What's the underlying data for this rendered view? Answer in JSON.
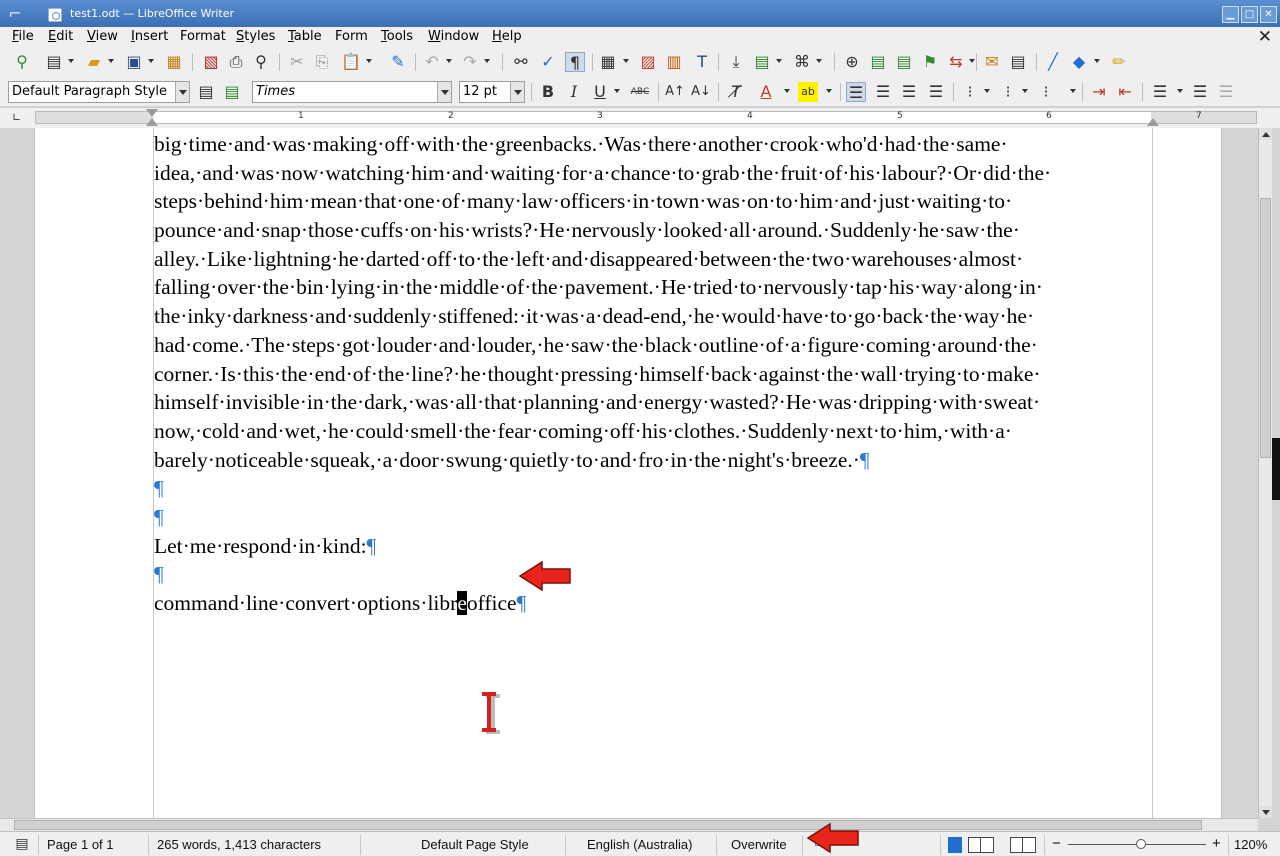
{
  "window": {
    "title": "test1.odt — LibreOffice Writer",
    "controls": {
      "minimize": "▁",
      "maximize": "□",
      "close": "✕"
    }
  },
  "menubar": {
    "items": [
      {
        "mnemonic": "F",
        "rest": "ile"
      },
      {
        "mnemonic": "E",
        "rest": "dit"
      },
      {
        "mnemonic": "V",
        "rest": "iew"
      },
      {
        "mnemonic": "I",
        "rest": "nsert"
      },
      {
        "mnemonic": "",
        "rest": "Format",
        "u": "o"
      },
      {
        "mnemonic": "S",
        "rest": "tyles"
      },
      {
        "mnemonic": "T",
        "rest": "able"
      },
      {
        "mnemonic": "",
        "rest": "Form"
      },
      {
        "mnemonic": "T",
        "rest": "ools"
      },
      {
        "mnemonic": "W",
        "rest": "indow"
      },
      {
        "mnemonic": "H",
        "rest": "elp"
      }
    ],
    "close_document": "✕"
  },
  "formatting": {
    "paragraph_style": "Default Paragraph Style",
    "font_name": "Times",
    "font_size": "12 pt"
  },
  "ruler": {
    "numbers": [
      "1",
      "2",
      "3",
      "4",
      "5",
      "6",
      "7"
    ]
  },
  "document": {
    "body_lines": [
      "big·time·and·was·making·off·with·the·greenbacks.·Was·there·another·crook·who'd·had·the·same·",
      "idea,·and·was·now·watching·him·and·waiting·for·a·chance·to·grab·the·fruit·of·his·labour?·Or·did·the·",
      "steps·behind·him·mean·that·one·of·many·law·officers·in·town·was·on·to·him·and·just·waiting·to·",
      "pounce·and·snap·those·cuffs·on·his·wrists?·He·nervously·looked·all·around.·Suddenly·he·saw·the·",
      "alley.·Like·lightning·he·darted·off·to·the·left·and·disappeared·between·the·two·warehouses·almost·",
      "falling·over·the·bin·lying·in·the·middle·of·the·pavement.·He·tried·to·nervously·tap·his·way·along·in·",
      "the·inky·darkness·and·suddenly·stiffened:·it·was·a·dead-end,·he·would·have·to·go·back·the·way·he·",
      "had·come.·The·steps·got·louder·and·louder,·he·saw·the·black·outline·of·a·figure·coming·around·the·",
      "corner.·Is·this·the·end·of·the·line?·he·thought·pressing·himself·back·against·the·wall·trying·to·make·",
      "himself·invisible·in·the·dark,·was·all·that·planning·and·energy·wasted?·He·was·dripping·with·sweat·",
      "now,·cold·and·wet,·he·could·smell·the·fear·coming·off·his·clothes.·Suddenly·next·to·him,·with·a·",
      "barely·noticeable·squeak,·a·door·swung·quietly·to·and·fro·in·the·night's·breeze.·"
    ],
    "pilcrow": "¶",
    "respond_line": "Let·me·respond·in·kind:",
    "command_line_before": "command·line·convert·options·libr",
    "command_line_cursor": "e",
    "command_line_after": "office"
  },
  "statusbar": {
    "page": "Page 1 of 1",
    "word_count": "265 words, 1,413 characters",
    "page_style": "Default Page Style",
    "language": "English (Australia)",
    "insert_mode": "Overwrite",
    "zoom_minus": "−",
    "zoom_plus": "+",
    "zoom_level": "120%"
  },
  "colors": {
    "title_bar": "#3b6fb6",
    "pilcrow": "#2a77d4",
    "annotation_arrow": "#e8251b",
    "ibeam": "#d32020"
  }
}
